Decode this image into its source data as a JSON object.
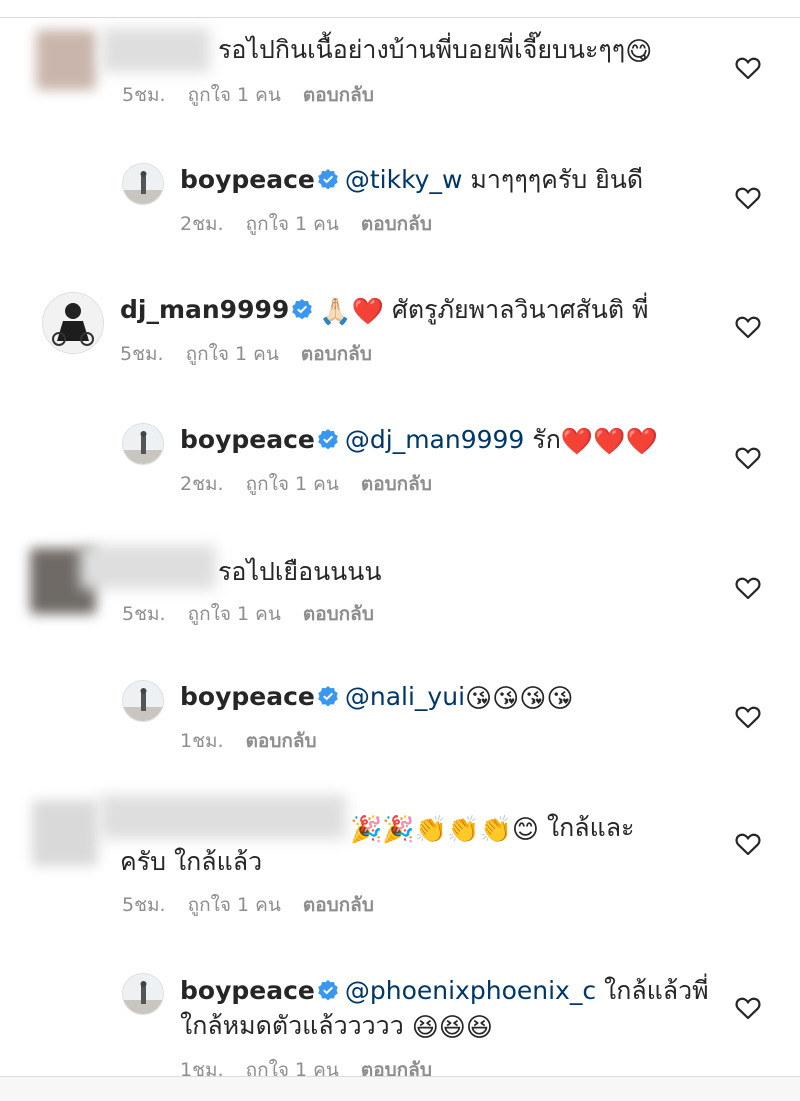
{
  "comments": [
    {
      "text": "รอไปกินเนื้อย่างบ้านพี่บอยพี่เจี๊ยบนะๆๆ",
      "emoji": "😋",
      "time": "5ชม.",
      "likes": "ถูกใจ 1 คน",
      "reply": "ตอบกลับ"
    },
    {
      "username": "boypeace",
      "mention": "@tikky_w",
      "text": " มาๆๆๆครับ ยินดี",
      "time": "2ชม.",
      "likes": "ถูกใจ 1 คน",
      "reply": "ตอบกลับ"
    },
    {
      "username": "dj_man9999",
      "emoji": "🙏🏻❤️",
      "text": " ศัตรูภัยพาลวินาศสันติ พี่",
      "time": "5ชม.",
      "likes": "ถูกใจ 1 คน",
      "reply": "ตอบกลับ"
    },
    {
      "username": "boypeace",
      "mention": "@dj_man9999",
      "text": " รัก",
      "emoji": "❤️❤️❤️",
      "time": "2ชม.",
      "likes": "ถูกใจ 1 คน",
      "reply": "ตอบกลับ"
    },
    {
      "text": "รอไปเยือนนนน",
      "time": "5ชม.",
      "likes": "ถูกใจ 1 คน",
      "reply": "ตอบกลับ"
    },
    {
      "username": "boypeace",
      "mention": "@nali_yui",
      "emoji": " 😘😘😘😘",
      "time": "1ชม.",
      "reply": "ตอบกลับ"
    },
    {
      "emoji": "🎉🎉👏👏👏😊",
      "text": " ใกล้และ",
      "text2": "ครับ ใกล้แล้ว",
      "time": "5ชม.",
      "likes": "ถูกใจ 1 คน",
      "reply": "ตอบกลับ"
    },
    {
      "username": "boypeace",
      "mention": "@phoenixphoenix_c",
      "text": " ใกล้แล้วพี่",
      "text2": "ใกล้หมดตัวแล้ววววว ",
      "emoji": "😆😆😆",
      "time": "1ชม.",
      "likes": "ถูกใจ 1 คน",
      "reply": "ตอบกลับ"
    }
  ],
  "icons": {
    "heart": "heart-outline-icon",
    "verified": "verified-badge-icon"
  },
  "colors": {
    "mention": "#00376b",
    "meta": "#8e8e8e",
    "text": "#262626",
    "verified": "#3897f0"
  }
}
